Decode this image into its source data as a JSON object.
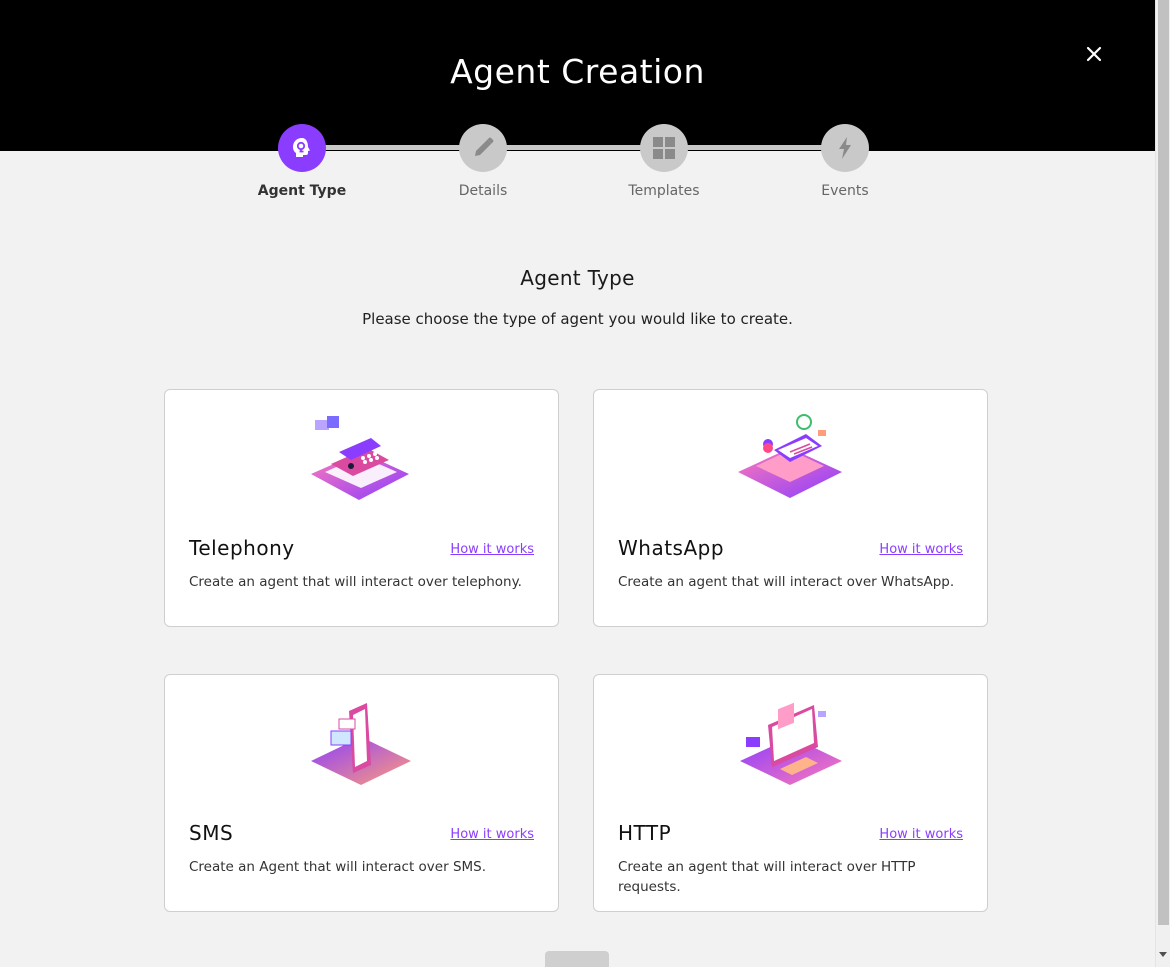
{
  "header": {
    "title": "Agent Creation",
    "close_icon": "close-icon"
  },
  "stepper": {
    "steps": [
      {
        "label": "Agent Type",
        "icon": "agent-head-icon",
        "active": true
      },
      {
        "label": "Details",
        "icon": "pencil-icon",
        "active": false
      },
      {
        "label": "Templates",
        "icon": "grid-icon",
        "active": false
      },
      {
        "label": "Events",
        "icon": "lightning-icon",
        "active": false
      }
    ]
  },
  "section": {
    "title": "Agent Type",
    "subtitle": "Please choose the type of agent you would like to create."
  },
  "cards": [
    {
      "name": "Telephony",
      "link": "How it works",
      "description": "Create an agent that will interact over telephony.",
      "illustration": "telephony-illustration"
    },
    {
      "name": "WhatsApp",
      "link": "How it works",
      "description": "Create an agent that will interact over WhatsApp.",
      "illustration": "whatsapp-illustration"
    },
    {
      "name": "SMS",
      "link": "How it works",
      "description": "Create an Agent that will interact over SMS.",
      "illustration": "sms-illustration"
    },
    {
      "name": "HTTP",
      "link": "How it works",
      "description": "Create an agent that will interact over HTTP requests.",
      "illustration": "http-illustration"
    }
  ],
  "colors": {
    "accent": "#8b3dff",
    "header_bg": "#000000",
    "page_bg": "#f2f2f2",
    "step_inactive": "#c9c9c9"
  }
}
